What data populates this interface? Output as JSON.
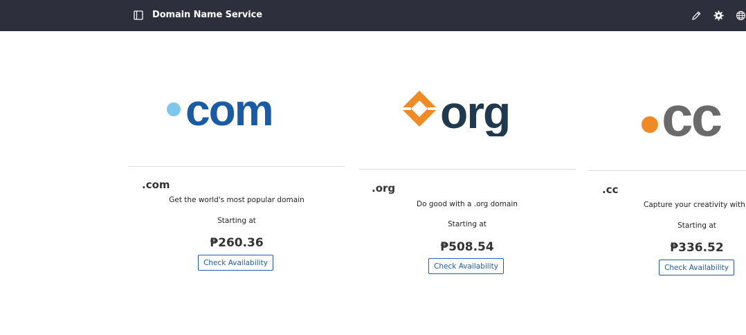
{
  "header": {
    "title": "Domain Name Service",
    "icons": [
      "sidebar-toggle-icon",
      "pencil-icon",
      "gear-icon",
      "globe-icon"
    ],
    "background": "#2d2f3d"
  },
  "domains": [
    {
      "tld": ".com",
      "logo_text": "com",
      "tagline": "Get the world's most popular domain",
      "starting_label": "Starting at",
      "price": "₱260.36",
      "button": "Check Availability",
      "logo_colors": {
        "dot": "#7ec8ef",
        "text": "#1a5ba6"
      }
    },
    {
      "tld": ".org",
      "logo_text": "org",
      "tagline": "Do good with a .org domain",
      "starting_label": "Starting at",
      "price": "₱508.54",
      "button": "Check Availability",
      "logo_colors": {
        "mark": "#f08a24",
        "text": "#1f3a4f"
      }
    },
    {
      "tld": ".cc",
      "logo_text": "cc",
      "tagline": "Capture your creativity with .c",
      "starting_label": "Starting at",
      "price": "₱336.52",
      "button": "Check Availability",
      "logo_colors": {
        "dot": "#f08a24",
        "text": "#6a6a6a"
      }
    }
  ],
  "accent": "#1b5ab5"
}
